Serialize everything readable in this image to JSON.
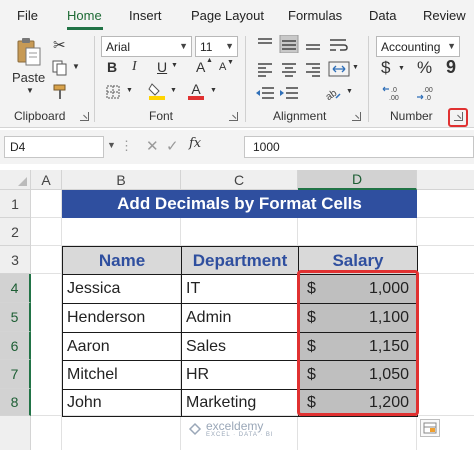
{
  "menu": {
    "tabs": [
      "File",
      "Home",
      "Insert",
      "Page Layout",
      "Formulas",
      "Data",
      "Review"
    ],
    "active": "Home"
  },
  "ribbon": {
    "clipboard": {
      "paste_label": "Paste",
      "group_label": "Clipboard"
    },
    "font": {
      "name": "Arial",
      "size": "11",
      "bold": "B",
      "italic": "I",
      "underline": "U",
      "grow": "A",
      "shrink": "A",
      "font_color_letter": "A",
      "group_label": "Font",
      "fill_color": "#ffd400",
      "font_color": "#e03131"
    },
    "alignment": {
      "group_label": "Alignment"
    },
    "number": {
      "format": "Accounting",
      "currency": "$",
      "percent": "%",
      "comma": "9",
      "group_label": "Number"
    }
  },
  "formula_bar": {
    "name_box": "D4",
    "fx_label": "fx",
    "value": "1000"
  },
  "grid": {
    "columns": [
      "A",
      "B",
      "C",
      "D"
    ],
    "rows": [
      "1",
      "2",
      "3",
      "4",
      "5",
      "6",
      "7",
      "8"
    ],
    "selected_column": "D",
    "selected_rows": [
      "4",
      "5",
      "6",
      "7",
      "8"
    ]
  },
  "sheet": {
    "title": "Add Decimals by Format Cells",
    "headers": [
      "Name",
      "Department",
      "Salary"
    ],
    "rows": [
      {
        "name": "Jessica",
        "department": "IT",
        "currency": "$",
        "salary": "1,000"
      },
      {
        "name": "Henderson",
        "department": "Admin",
        "currency": "$",
        "salary": "1,100"
      },
      {
        "name": "Aaron",
        "department": "Sales",
        "currency": "$",
        "salary": "1,150"
      },
      {
        "name": "Mitchel",
        "department": "HR",
        "currency": "$",
        "salary": "1,050"
      },
      {
        "name": "John",
        "department": "Marketing",
        "currency": "$",
        "salary": "1,200"
      }
    ]
  },
  "watermark": {
    "name": "exceldemy",
    "tagline": "EXCEL · DATA · BI"
  },
  "colors": {
    "accent": "#217346",
    "title_fill": "#2f4f9f",
    "highlight": "#e03131",
    "salary_fill": "#bfbfbf"
  }
}
